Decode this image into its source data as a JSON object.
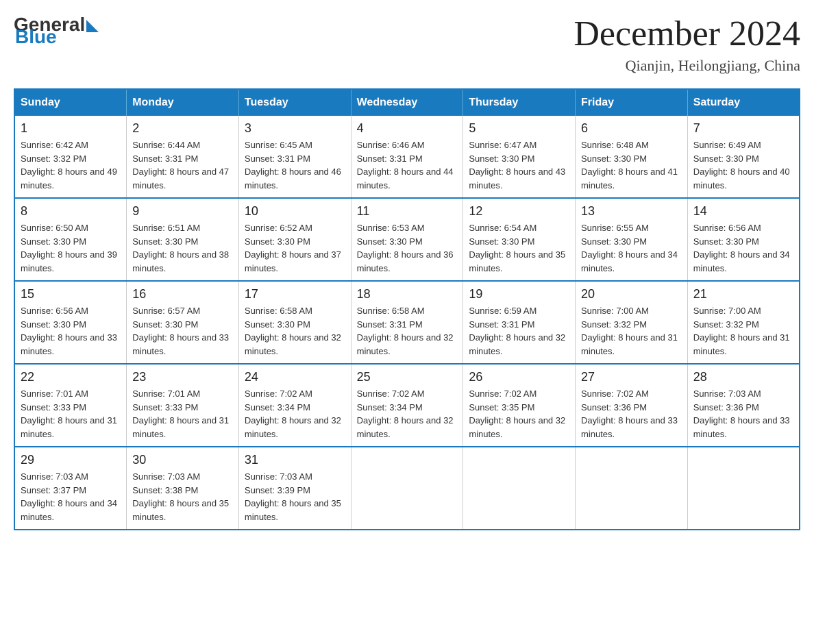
{
  "logo": {
    "general": "General",
    "blue": "Blue"
  },
  "title": "December 2024",
  "subtitle": "Qianjin, Heilongjiang, China",
  "days_of_week": [
    "Sunday",
    "Monday",
    "Tuesday",
    "Wednesday",
    "Thursday",
    "Friday",
    "Saturday"
  ],
  "weeks": [
    [
      {
        "day": "1",
        "sunrise": "6:42 AM",
        "sunset": "3:32 PM",
        "daylight": "8 hours and 49 minutes."
      },
      {
        "day": "2",
        "sunrise": "6:44 AM",
        "sunset": "3:31 PM",
        "daylight": "8 hours and 47 minutes."
      },
      {
        "day": "3",
        "sunrise": "6:45 AM",
        "sunset": "3:31 PM",
        "daylight": "8 hours and 46 minutes."
      },
      {
        "day": "4",
        "sunrise": "6:46 AM",
        "sunset": "3:31 PM",
        "daylight": "8 hours and 44 minutes."
      },
      {
        "day": "5",
        "sunrise": "6:47 AM",
        "sunset": "3:30 PM",
        "daylight": "8 hours and 43 minutes."
      },
      {
        "day": "6",
        "sunrise": "6:48 AM",
        "sunset": "3:30 PM",
        "daylight": "8 hours and 41 minutes."
      },
      {
        "day": "7",
        "sunrise": "6:49 AM",
        "sunset": "3:30 PM",
        "daylight": "8 hours and 40 minutes."
      }
    ],
    [
      {
        "day": "8",
        "sunrise": "6:50 AM",
        "sunset": "3:30 PM",
        "daylight": "8 hours and 39 minutes."
      },
      {
        "day": "9",
        "sunrise": "6:51 AM",
        "sunset": "3:30 PM",
        "daylight": "8 hours and 38 minutes."
      },
      {
        "day": "10",
        "sunrise": "6:52 AM",
        "sunset": "3:30 PM",
        "daylight": "8 hours and 37 minutes."
      },
      {
        "day": "11",
        "sunrise": "6:53 AM",
        "sunset": "3:30 PM",
        "daylight": "8 hours and 36 minutes."
      },
      {
        "day": "12",
        "sunrise": "6:54 AM",
        "sunset": "3:30 PM",
        "daylight": "8 hours and 35 minutes."
      },
      {
        "day": "13",
        "sunrise": "6:55 AM",
        "sunset": "3:30 PM",
        "daylight": "8 hours and 34 minutes."
      },
      {
        "day": "14",
        "sunrise": "6:56 AM",
        "sunset": "3:30 PM",
        "daylight": "8 hours and 34 minutes."
      }
    ],
    [
      {
        "day": "15",
        "sunrise": "6:56 AM",
        "sunset": "3:30 PM",
        "daylight": "8 hours and 33 minutes."
      },
      {
        "day": "16",
        "sunrise": "6:57 AM",
        "sunset": "3:30 PM",
        "daylight": "8 hours and 33 minutes."
      },
      {
        "day": "17",
        "sunrise": "6:58 AM",
        "sunset": "3:30 PM",
        "daylight": "8 hours and 32 minutes."
      },
      {
        "day": "18",
        "sunrise": "6:58 AM",
        "sunset": "3:31 PM",
        "daylight": "8 hours and 32 minutes."
      },
      {
        "day": "19",
        "sunrise": "6:59 AM",
        "sunset": "3:31 PM",
        "daylight": "8 hours and 32 minutes."
      },
      {
        "day": "20",
        "sunrise": "7:00 AM",
        "sunset": "3:32 PM",
        "daylight": "8 hours and 31 minutes."
      },
      {
        "day": "21",
        "sunrise": "7:00 AM",
        "sunset": "3:32 PM",
        "daylight": "8 hours and 31 minutes."
      }
    ],
    [
      {
        "day": "22",
        "sunrise": "7:01 AM",
        "sunset": "3:33 PM",
        "daylight": "8 hours and 31 minutes."
      },
      {
        "day": "23",
        "sunrise": "7:01 AM",
        "sunset": "3:33 PM",
        "daylight": "8 hours and 31 minutes."
      },
      {
        "day": "24",
        "sunrise": "7:02 AM",
        "sunset": "3:34 PM",
        "daylight": "8 hours and 32 minutes."
      },
      {
        "day": "25",
        "sunrise": "7:02 AM",
        "sunset": "3:34 PM",
        "daylight": "8 hours and 32 minutes."
      },
      {
        "day": "26",
        "sunrise": "7:02 AM",
        "sunset": "3:35 PM",
        "daylight": "8 hours and 32 minutes."
      },
      {
        "day": "27",
        "sunrise": "7:02 AM",
        "sunset": "3:36 PM",
        "daylight": "8 hours and 33 minutes."
      },
      {
        "day": "28",
        "sunrise": "7:03 AM",
        "sunset": "3:36 PM",
        "daylight": "8 hours and 33 minutes."
      }
    ],
    [
      {
        "day": "29",
        "sunrise": "7:03 AM",
        "sunset": "3:37 PM",
        "daylight": "8 hours and 34 minutes."
      },
      {
        "day": "30",
        "sunrise": "7:03 AM",
        "sunset": "3:38 PM",
        "daylight": "8 hours and 35 minutes."
      },
      {
        "day": "31",
        "sunrise": "7:03 AM",
        "sunset": "3:39 PM",
        "daylight": "8 hours and 35 minutes."
      },
      null,
      null,
      null,
      null
    ]
  ]
}
